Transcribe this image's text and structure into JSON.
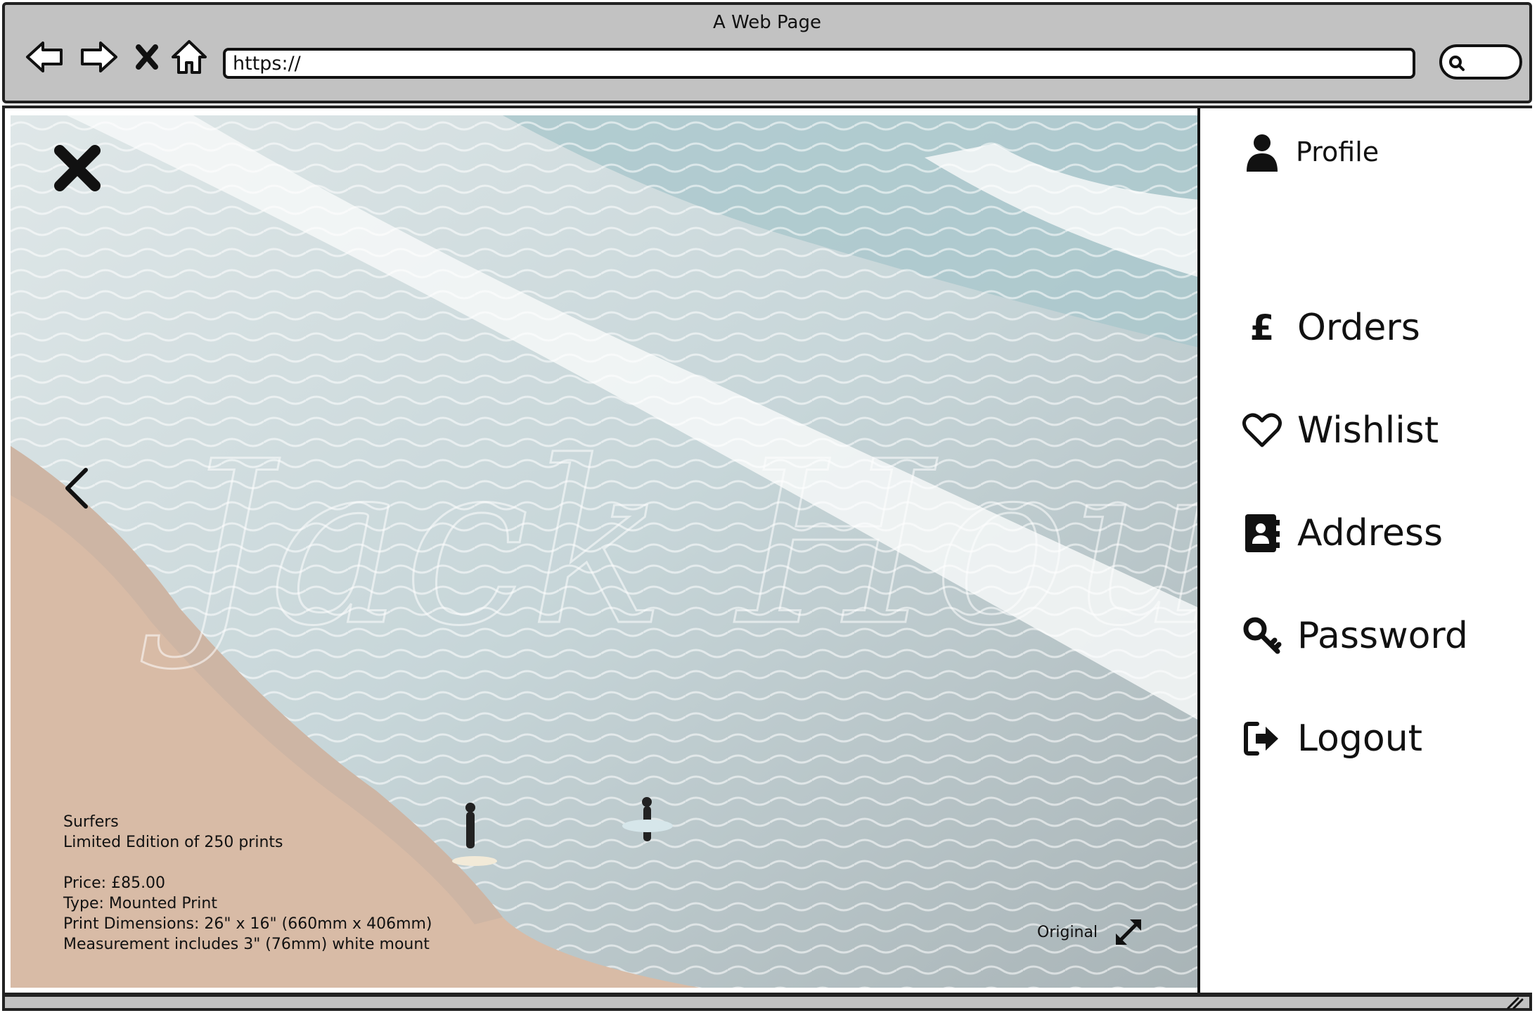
{
  "browser": {
    "title": "A Web Page",
    "url": "https://",
    "nav_icons": [
      "back-arrow-icon",
      "forward-arrow-icon",
      "stop-x-icon",
      "home-icon"
    ],
    "search_icon": "search-icon"
  },
  "viewer": {
    "close_icon": "close-icon",
    "prev_icon": "chevron-left-icon",
    "info": {
      "title": "Surfers",
      "edition": "Limited Edition of 250 prints",
      "price": "Price: £85.00",
      "type": "Type: Mounted Print",
      "dimensions": "Print Dimensions: 26\" x 16\" (660mm x 406mm)",
      "mount": "Measurement includes 3\" (76mm) white mount"
    },
    "original_label": "Original",
    "expand_icon": "expand-arrows-icon"
  },
  "sidebar": {
    "items": [
      {
        "label": "Profile",
        "icon": "user-icon"
      },
      {
        "label": "Orders",
        "icon": "pound-icon"
      },
      {
        "label": "Wishlist",
        "icon": "heart-icon"
      },
      {
        "label": "Address",
        "icon": "address-book-icon"
      },
      {
        "label": "Password",
        "icon": "key-icon"
      },
      {
        "label": "Logout",
        "icon": "logout-icon"
      }
    ]
  },
  "colors": {
    "chrome": "#c2c2c2",
    "sand": "#d9b9a0",
    "sea": "#b9cfd3",
    "foam": "#f4f6f6"
  }
}
